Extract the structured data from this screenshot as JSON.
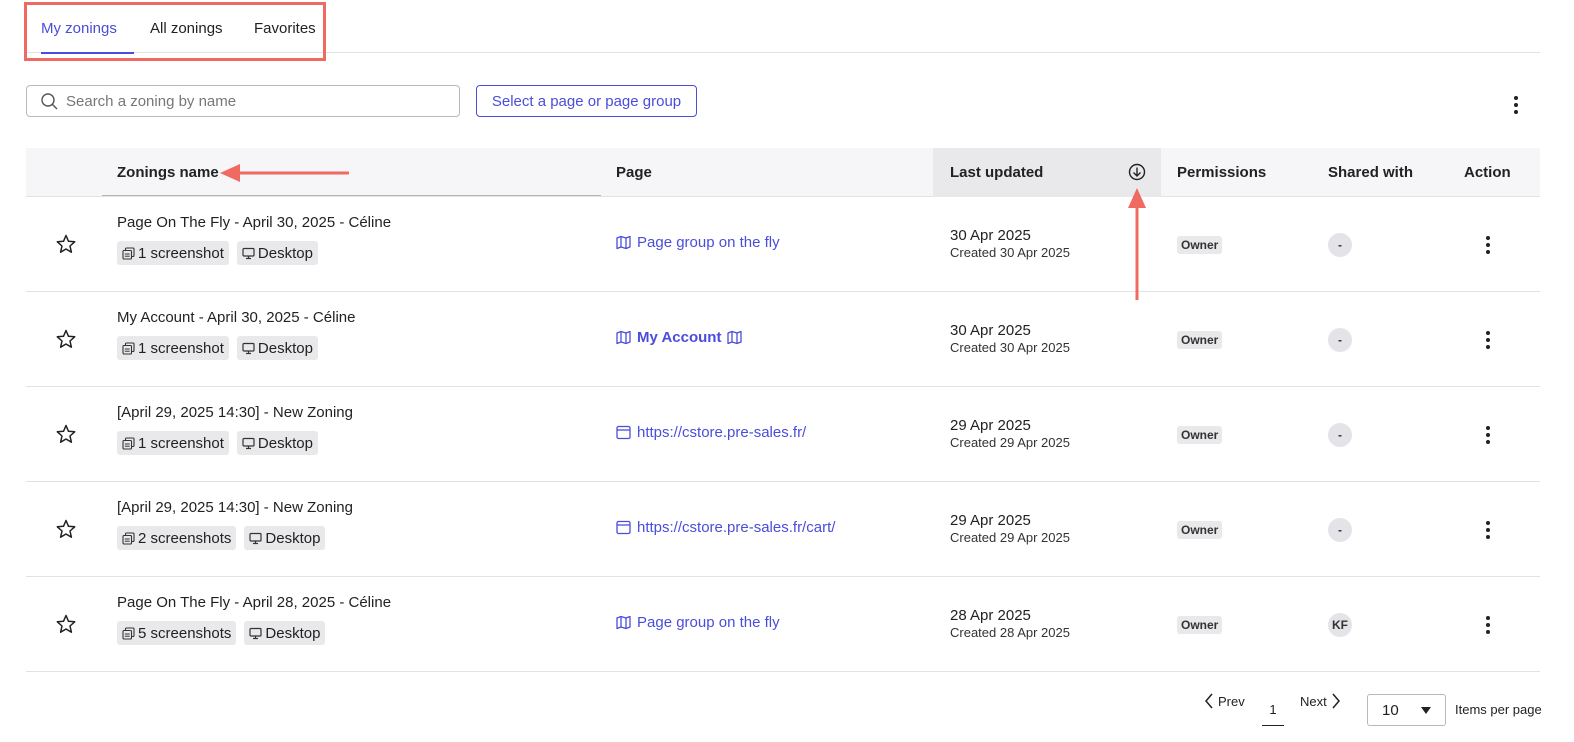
{
  "tabs": [
    {
      "label": "My zonings",
      "active": true
    },
    {
      "label": "All zonings",
      "active": false
    },
    {
      "label": "Favorites",
      "active": false
    }
  ],
  "search": {
    "placeholder": "Search a zoning by name"
  },
  "toolbar": {
    "select_page_label": "Select a page or page group"
  },
  "table": {
    "headers": {
      "name": "Zonings name",
      "page": "Page",
      "last_updated": "Last updated",
      "permissions": "Permissions",
      "shared_with": "Shared with",
      "action": "Action"
    },
    "rows": [
      {
        "name": "Page On The Fly - April 30, 2025 - Céline",
        "screenshots": "1 screenshot",
        "device": "Desktop",
        "page": "Page group on the fly",
        "page_type": "page-group",
        "updated": "30 Apr 2025",
        "created": "Created 30 Apr 2025",
        "permission": "Owner",
        "shared": "-"
      },
      {
        "name": "My Account - April 30, 2025 - Céline",
        "screenshots": "1 screenshot",
        "device": "Desktop",
        "page": "My Account",
        "page_type": "page-group-bold",
        "updated": "30 Apr 2025",
        "created": "Created 30 Apr 2025",
        "permission": "Owner",
        "shared": "-"
      },
      {
        "name": "[April 29, 2025 14:30] - New Zoning",
        "screenshots": "1 screenshot",
        "device": "Desktop",
        "page": "https://cstore.pre-sales.fr/",
        "page_type": "url",
        "updated": "29 Apr 2025",
        "created": "Created 29 Apr 2025",
        "permission": "Owner",
        "shared": "-"
      },
      {
        "name": "[April 29, 2025 14:30] - New Zoning",
        "screenshots": "2 screenshots",
        "device": "Desktop",
        "page": "https://cstore.pre-sales.fr/cart/",
        "page_type": "url",
        "updated": "29 Apr 2025",
        "created": "Created 29 Apr 2025",
        "permission": "Owner",
        "shared": "-"
      },
      {
        "name": "Page On The Fly - April 28, 2025 - Céline",
        "screenshots": "5 screenshots",
        "device": "Desktop",
        "page": "Page group on the fly",
        "page_type": "page-group",
        "updated": "28 Apr 2025",
        "created": "Created 28 Apr 2025",
        "permission": "Owner",
        "shared": "KF"
      }
    ]
  },
  "pagination": {
    "prev": "Prev",
    "current": "1",
    "next": "Next",
    "per_page": "10",
    "per_page_label": "Items per page"
  },
  "colors": {
    "accent": "#4a4ddb",
    "annotation": "#ef6b62"
  }
}
